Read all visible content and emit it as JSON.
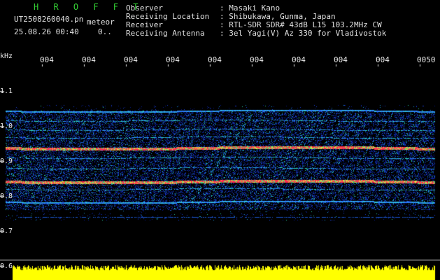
{
  "header": {
    "title": "H R O F F T",
    "file_name": "UT2508260040.pn",
    "type": "meteor",
    "date_time": "25.08.26 00:40",
    "count": "0..",
    "observer_label": "Observer",
    "observer_value": ": Masaki Kano",
    "location_label": "Receiving Location",
    "location_value": ": Shibukawa, Gunma, Japan",
    "receiver_label": "Receiver",
    "receiver_value": ": RTL-SDR SDR# 43dB L15 103.2MHz CW",
    "antenna_label": "Receiving Antenna",
    "antenna_value": ": 3el Yagi(V) Az 330 for Vladivostok"
  },
  "axis": {
    "unit": "kHz",
    "y_ticks": [
      "1.1",
      "1.0",
      "0.9",
      "0.8",
      "0.7",
      "0.6"
    ],
    "x_ticks": [
      "004",
      "004",
      "004",
      "004",
      "004",
      "004",
      "004",
      "004",
      "004",
      "0050"
    ]
  },
  "colors": {
    "background": "#000000",
    "spectrum_low": "#00208c",
    "spectrum_mid": "#00c8c8",
    "spectrum_high": "#ff2a50",
    "amplitude": "#ffff00",
    "title": "#34d134"
  }
}
